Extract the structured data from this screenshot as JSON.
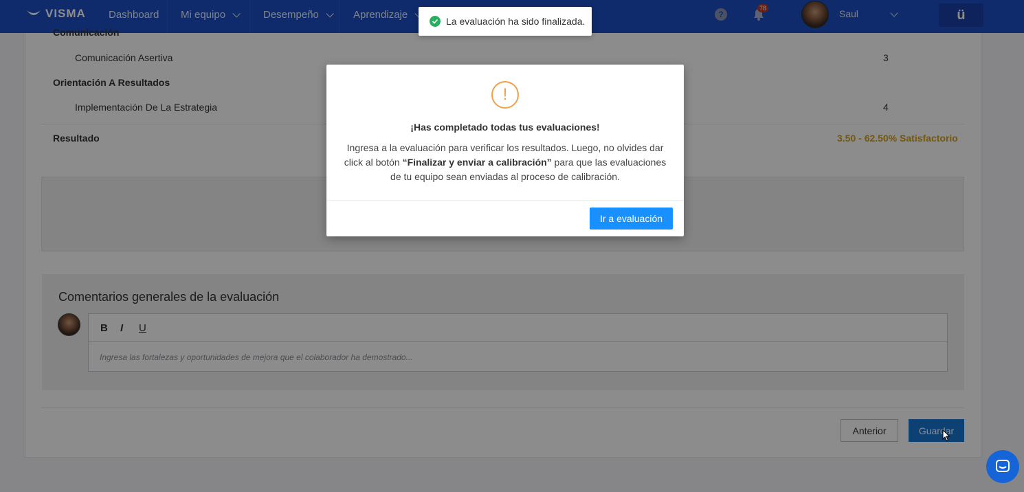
{
  "nav": {
    "logo_text": "VISMA",
    "items": [
      {
        "label": "Dashboard"
      },
      {
        "label": "Mi equipo"
      },
      {
        "label": "Desempeño"
      },
      {
        "label": "Aprendizaje"
      }
    ],
    "help_symbol": "?",
    "notifications_count": "78",
    "user_name": "Saul",
    "app_button_symbol": "ü"
  },
  "evaluation": {
    "section_partial": "Comunicación",
    "rows": [
      {
        "label": "Comunicación Asertiva",
        "value": "3"
      },
      {
        "label": "Orientación A Resultados",
        "value": ""
      },
      {
        "label": "Implementación De La Estrategia",
        "value": "4"
      }
    ],
    "result_label": "Resultado",
    "result_value": "3.50 - 62.50% Satisfactorio"
  },
  "comments": {
    "title": "Comentarios generales de la evaluación",
    "toolbar": {
      "bold": "B",
      "italic": "I",
      "underline": "U"
    },
    "placeholder": "Ingresa las fortalezas y oportunidades de mejora que el colaborador ha demostrado..."
  },
  "footer": {
    "prev_label": "Anterior",
    "save_label": "Guardar"
  },
  "toast": {
    "message": "La evaluación ha sido finalizada."
  },
  "modal": {
    "icon_symbol": "!",
    "title": "¡Has completado todas tus evaluaciones!",
    "body_before": "Ingresa a la evaluación para verificar los resultados. Luego, no olvides dar click al botón ",
    "body_bold": "“Finalizar y enviar a calibración”",
    "body_after": " para que las evaluaciones de tu equipo sean enviadas al proceso de calibración.",
    "button_label": "Ir a evaluación"
  },
  "colors": {
    "nav_bg": "#1d4fc4",
    "primary_button": "#1890ff",
    "result_gold": "#d4a017",
    "warning": "#f0a04b",
    "success": "#27ae60"
  }
}
